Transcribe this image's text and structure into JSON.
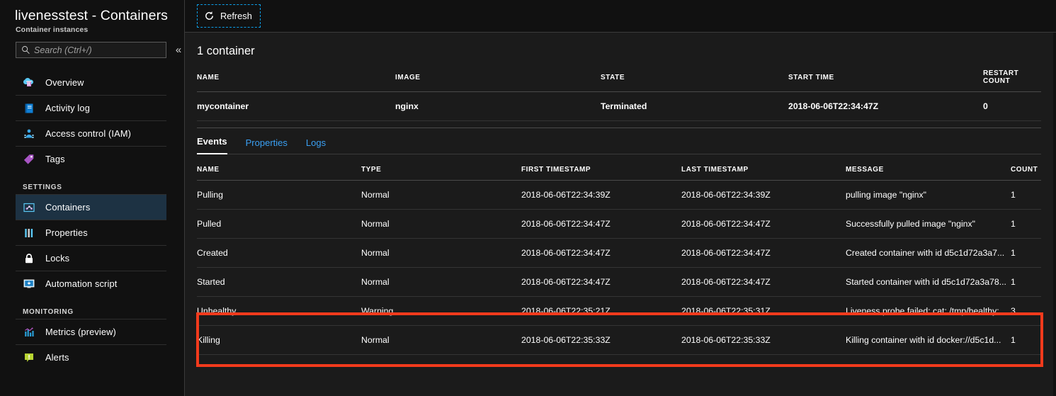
{
  "blade": {
    "title": "livenesstest - Containers",
    "subtitle": "Container instances"
  },
  "search": {
    "placeholder": "Search (Ctrl+/)",
    "value": "",
    "collapse_glyph": "«"
  },
  "sidebar": {
    "items": [
      {
        "label": "Overview",
        "icon": "overview-icon",
        "selected": false
      },
      {
        "label": "Activity log",
        "icon": "activity-log-icon",
        "selected": false
      },
      {
        "label": "Access control (IAM)",
        "icon": "access-control-icon",
        "selected": false
      },
      {
        "label": "Tags",
        "icon": "tags-icon",
        "selected": false
      }
    ],
    "groups": [
      {
        "label": "SETTINGS",
        "items": [
          {
            "label": "Containers",
            "icon": "containers-icon",
            "selected": true
          },
          {
            "label": "Properties",
            "icon": "properties-icon",
            "selected": false
          },
          {
            "label": "Locks",
            "icon": "lock-icon",
            "selected": false
          },
          {
            "label": "Automation script",
            "icon": "automation-script-icon",
            "selected": false
          }
        ]
      },
      {
        "label": "MONITORING",
        "items": [
          {
            "label": "Metrics (preview)",
            "icon": "metrics-icon",
            "selected": false
          },
          {
            "label": "Alerts",
            "icon": "alerts-icon",
            "selected": false
          }
        ]
      }
    ]
  },
  "toolbar": {
    "refresh_label": "Refresh",
    "refresh_icon": "refresh-icon"
  },
  "containers_section": {
    "title": "1 container",
    "columns": [
      "NAME",
      "IMAGE",
      "STATE",
      "START TIME",
      "RESTART COUNT"
    ],
    "rows": [
      {
        "name": "mycontainer",
        "image": "nginx",
        "state": "Terminated",
        "start_time": "2018-06-06T22:34:47Z",
        "restart_count": "0"
      }
    ]
  },
  "tabs": [
    {
      "label": "Events",
      "active": true
    },
    {
      "label": "Properties",
      "active": false
    },
    {
      "label": "Logs",
      "active": false
    }
  ],
  "events_section": {
    "columns": [
      "NAME",
      "TYPE",
      "FIRST TIMESTAMP",
      "LAST TIMESTAMP",
      "MESSAGE",
      "COUNT"
    ],
    "rows": [
      {
        "name": "Pulling",
        "type": "Normal",
        "first_timestamp": "2018-06-06T22:34:39Z",
        "last_timestamp": "2018-06-06T22:34:39Z",
        "message": "pulling image \"nginx\"",
        "count": "1",
        "highlighted": false
      },
      {
        "name": "Pulled",
        "type": "Normal",
        "first_timestamp": "2018-06-06T22:34:47Z",
        "last_timestamp": "2018-06-06T22:34:47Z",
        "message": "Successfully pulled image \"nginx\"",
        "count": "1",
        "highlighted": false
      },
      {
        "name": "Created",
        "type": "Normal",
        "first_timestamp": "2018-06-06T22:34:47Z",
        "last_timestamp": "2018-06-06T22:34:47Z",
        "message": "Created container with id d5c1d72a3a7...",
        "count": "1",
        "highlighted": false
      },
      {
        "name": "Started",
        "type": "Normal",
        "first_timestamp": "2018-06-06T22:34:47Z",
        "last_timestamp": "2018-06-06T22:34:47Z",
        "message": "Started container with id d5c1d72a3a78...",
        "count": "1",
        "highlighted": false
      },
      {
        "name": "Unhealthy",
        "type": "Warning",
        "first_timestamp": "2018-06-06T22:35:21Z",
        "last_timestamp": "2018-06-06T22:35:31Z",
        "message": "Liveness probe failed: cat: /tmp/healthy:...",
        "count": "3",
        "highlighted": true
      },
      {
        "name": "Killing",
        "type": "Normal",
        "first_timestamp": "2018-06-06T22:35:33Z",
        "last_timestamp": "2018-06-06T22:35:33Z",
        "message": "Killing container with id docker://d5c1d...",
        "count": "1",
        "highlighted": true
      }
    ]
  },
  "colors": {
    "background": "#111111",
    "panel": "#1b1b1b",
    "selected_nav": "#1d3243",
    "link_blue": "#3aa0f3",
    "focus_blue": "#0c9ee8",
    "highlight_red": "#f23a1c"
  }
}
